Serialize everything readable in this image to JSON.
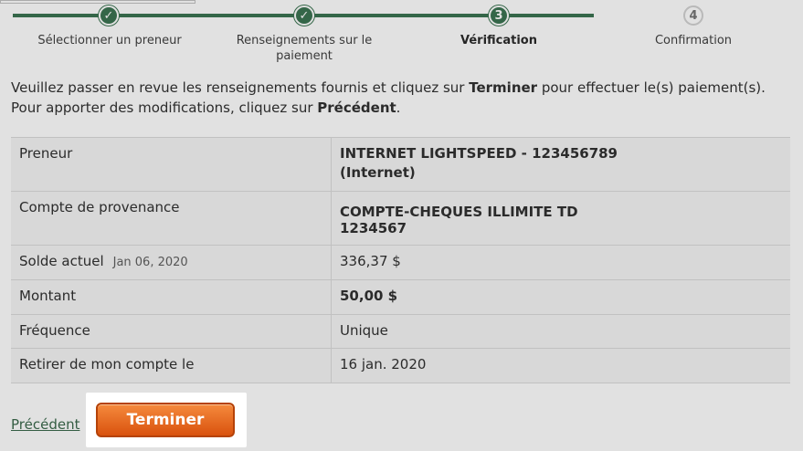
{
  "steps": [
    {
      "number": "1",
      "label": "Sélectionner un preneur",
      "state": "done"
    },
    {
      "number": "2",
      "label": "Renseignements sur le paiement",
      "state": "done"
    },
    {
      "number": "3",
      "label": "Vérification",
      "state": "current"
    },
    {
      "number": "4",
      "label": "Confirmation",
      "state": "todo"
    }
  ],
  "icons": {
    "done": "check-icon"
  },
  "colors": {
    "accent": "#2d6a45",
    "button": "#e8651f"
  },
  "intro": {
    "line1_a": "Veuillez passer en revue les renseignements fournis et cliquez sur ",
    "line1_b": "Terminer",
    "line1_c": " pour effectuer le(s) paiement(s).",
    "line2_a": "Pour apporter des modifications, cliquez sur ",
    "line2_b": "Précédent",
    "line2_c": "."
  },
  "summary": {
    "payee_label": "Preneur",
    "payee_value_1": "INTERNET LIGHTSPEED - 123456789",
    "payee_value_2": "(Internet)",
    "from_label": "Compte de provenance",
    "from_value_1": "COMPTE-CHEQUES ILLIMITE TD",
    "from_value_2": "1234567",
    "balance_label": "Solde actuel",
    "balance_date": "Jan 06, 2020",
    "balance_value": "336,37 $",
    "amount_label": "Montant",
    "amount_value": "50,00 $",
    "frequency_label": "Fréquence",
    "frequency_value": "Unique",
    "withdraw_label": "Retirer de mon compte le",
    "withdraw_value": "16 jan. 2020"
  },
  "actions": {
    "previous": "Précédent",
    "finish": "Terminer"
  }
}
